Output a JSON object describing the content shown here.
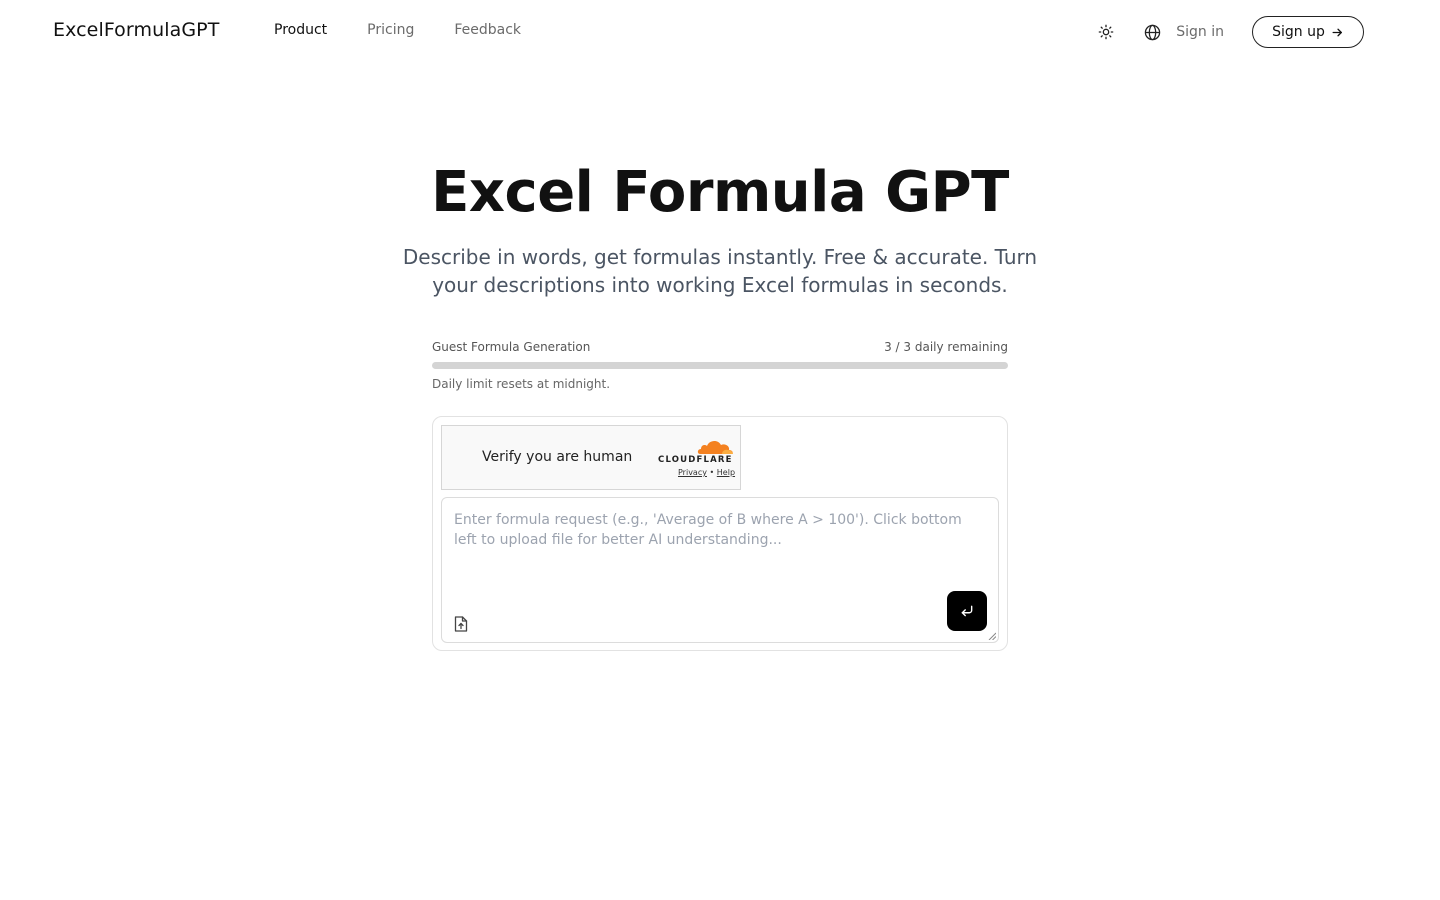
{
  "header": {
    "logo": "ExcelFormulaGPT",
    "nav": [
      "Product",
      "Pricing",
      "Feedback"
    ],
    "sign_in": "Sign in",
    "sign_up": "Sign up",
    "icons": [
      "sun-icon",
      "globe-icon",
      "arrow-right-icon"
    ]
  },
  "hero": {
    "title": "Excel Formula GPT",
    "subtitle": "Describe in words, get formulas instantly. Free & accurate. Turn your descriptions into working Excel formulas in seconds."
  },
  "usage": {
    "label": "Guest Formula Generation",
    "remaining": "3 / 3 daily remaining",
    "progress_fraction": 0,
    "note": "Daily limit resets at midnight."
  },
  "captcha": {
    "text": "Verify you are human",
    "brand": "CLOUDFLARE",
    "privacy": "Privacy",
    "separator": "•",
    "help": "Help"
  },
  "input": {
    "placeholder": "Enter formula request (e.g., 'Average of B where A > 100'). Click bottom left to upload file for better AI understanding..."
  },
  "colors": {
    "accent": "#000000",
    "cloudflare": "#f48120",
    "muted_text": "#6b6b6b"
  }
}
